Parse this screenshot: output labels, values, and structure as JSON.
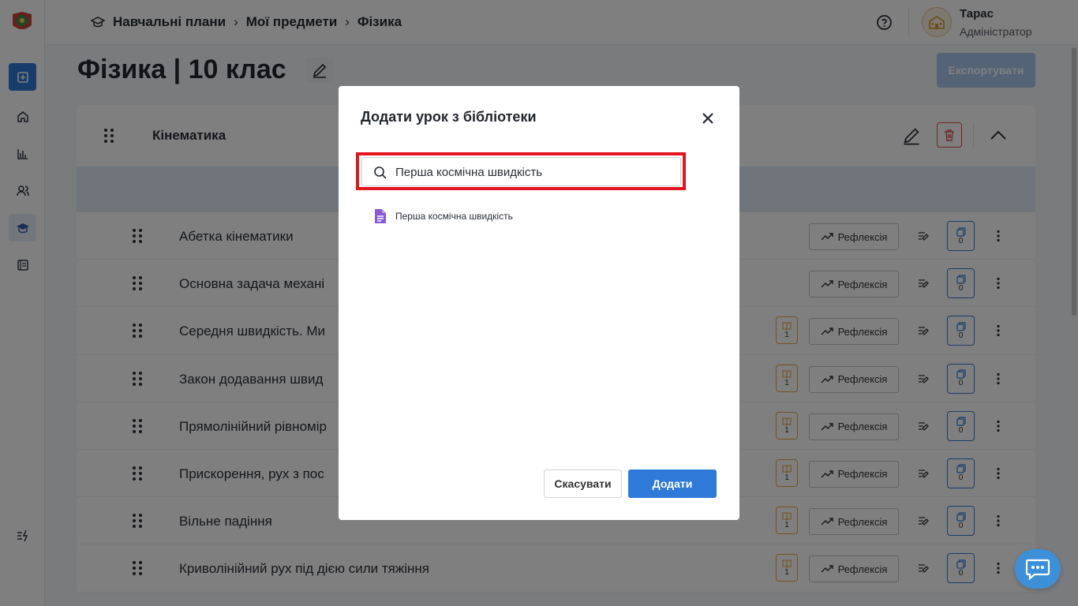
{
  "breadcrumbs": [
    "Навчальні плани",
    "Мої предмети",
    "Фізика"
  ],
  "user": {
    "name": "Тарас",
    "role": "Адміністратор"
  },
  "page": {
    "title": "Фізика | 10 клас",
    "export_label": "Експортувати"
  },
  "module": {
    "name": "Кінематика"
  },
  "lessons": [
    {
      "title": "Абетка кінематики",
      "books": "",
      "reflection": "Рефлексія",
      "copies": "0"
    },
    {
      "title": "Основна задача механі",
      "books": "",
      "reflection": "Рефлексія",
      "copies": "0"
    },
    {
      "title": "Середня швидкість. Ми",
      "books": "1",
      "reflection": "Рефлексія",
      "copies": "0"
    },
    {
      "title": "Закон додавання швид",
      "books": "1",
      "reflection": "Рефлексія",
      "copies": "0"
    },
    {
      "title": "Прямолінійний рівномір",
      "books": "1",
      "reflection": "Рефлексія",
      "copies": "0"
    },
    {
      "title": "Прискорення, рух з пос",
      "books": "1",
      "reflection": "Рефлексія",
      "copies": "0"
    },
    {
      "title": "Вільне падіння",
      "books": "1",
      "reflection": "Рефлексія",
      "copies": "0"
    },
    {
      "title": "Криволінійний рух під дією сили тяжіння",
      "books": "1",
      "reflection": "Рефлексія",
      "copies": "0"
    }
  ],
  "modal": {
    "title": "Додати урок з бібліотеки",
    "search_value": "Перша космічна швидкість",
    "results": [
      "Перша космічна швидкість"
    ],
    "cancel_label": "Скасувати",
    "add_label": "Додати"
  },
  "colors": {
    "accent": "#2f7ad9",
    "danger": "#e14b4b",
    "highlight": "#e3151f",
    "book": "#e9a441",
    "doc": "#8a5bd6"
  }
}
